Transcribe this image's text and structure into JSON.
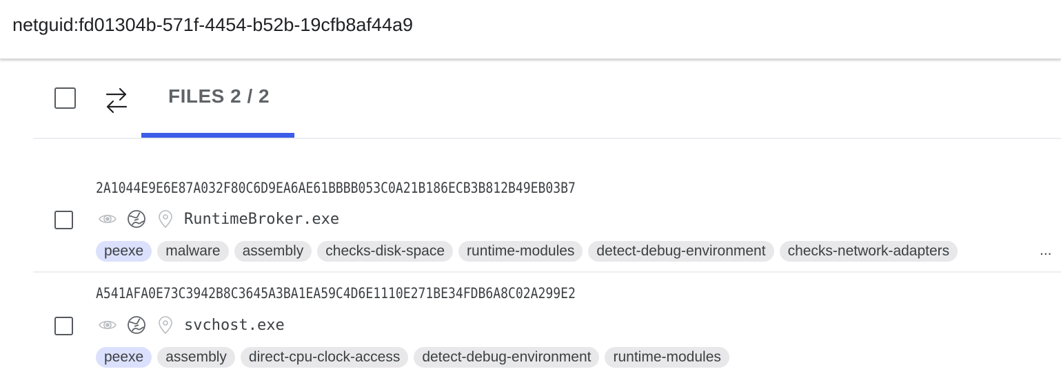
{
  "search": {
    "value": "netguid:fd01304b-571f-4454-b52b-19cfb8af44a9",
    "icon": "search-field"
  },
  "toolbar": {
    "select_all_icon": "checkbox-icon",
    "swap_icon": "swap-arrows-icon",
    "tab_label": "FILES 2 / 2",
    "tab_selected": true,
    "accent_color": "#3b5de7"
  },
  "files": [
    {
      "hash": "2A1044E9E6E87A032F80C6D9EA6AE61BBBB053C0A21B186ECB3B812B49EB03B7",
      "name": "RuntimeBroker.exe",
      "icons": [
        "eye-icon",
        "globe-icon",
        "location-pin-icon"
      ],
      "tags": [
        "peexe",
        "malware",
        "assembly",
        "checks-disk-space",
        "runtime-modules",
        "detect-debug-environment",
        "checks-network-adapters"
      ],
      "more": "..."
    },
    {
      "hash": "A541AFA0E73C3942B8C3645A3BA1EA59C4D6E1110E271BE34FDB6A8C02A299E2",
      "name": "svchost.exe",
      "icons": [
        "eye-icon",
        "globe-icon",
        "location-pin-icon"
      ],
      "tags": [
        "peexe",
        "assembly",
        "direct-cpu-clock-access",
        "detect-debug-environment",
        "runtime-modules"
      ]
    }
  ],
  "colors": {
    "first_tag_bg": "#dbe0fd",
    "tag_bg": "#e8e8ea",
    "icon_muted": "#b9bcc0",
    "icon_dark": "#5f6368"
  }
}
